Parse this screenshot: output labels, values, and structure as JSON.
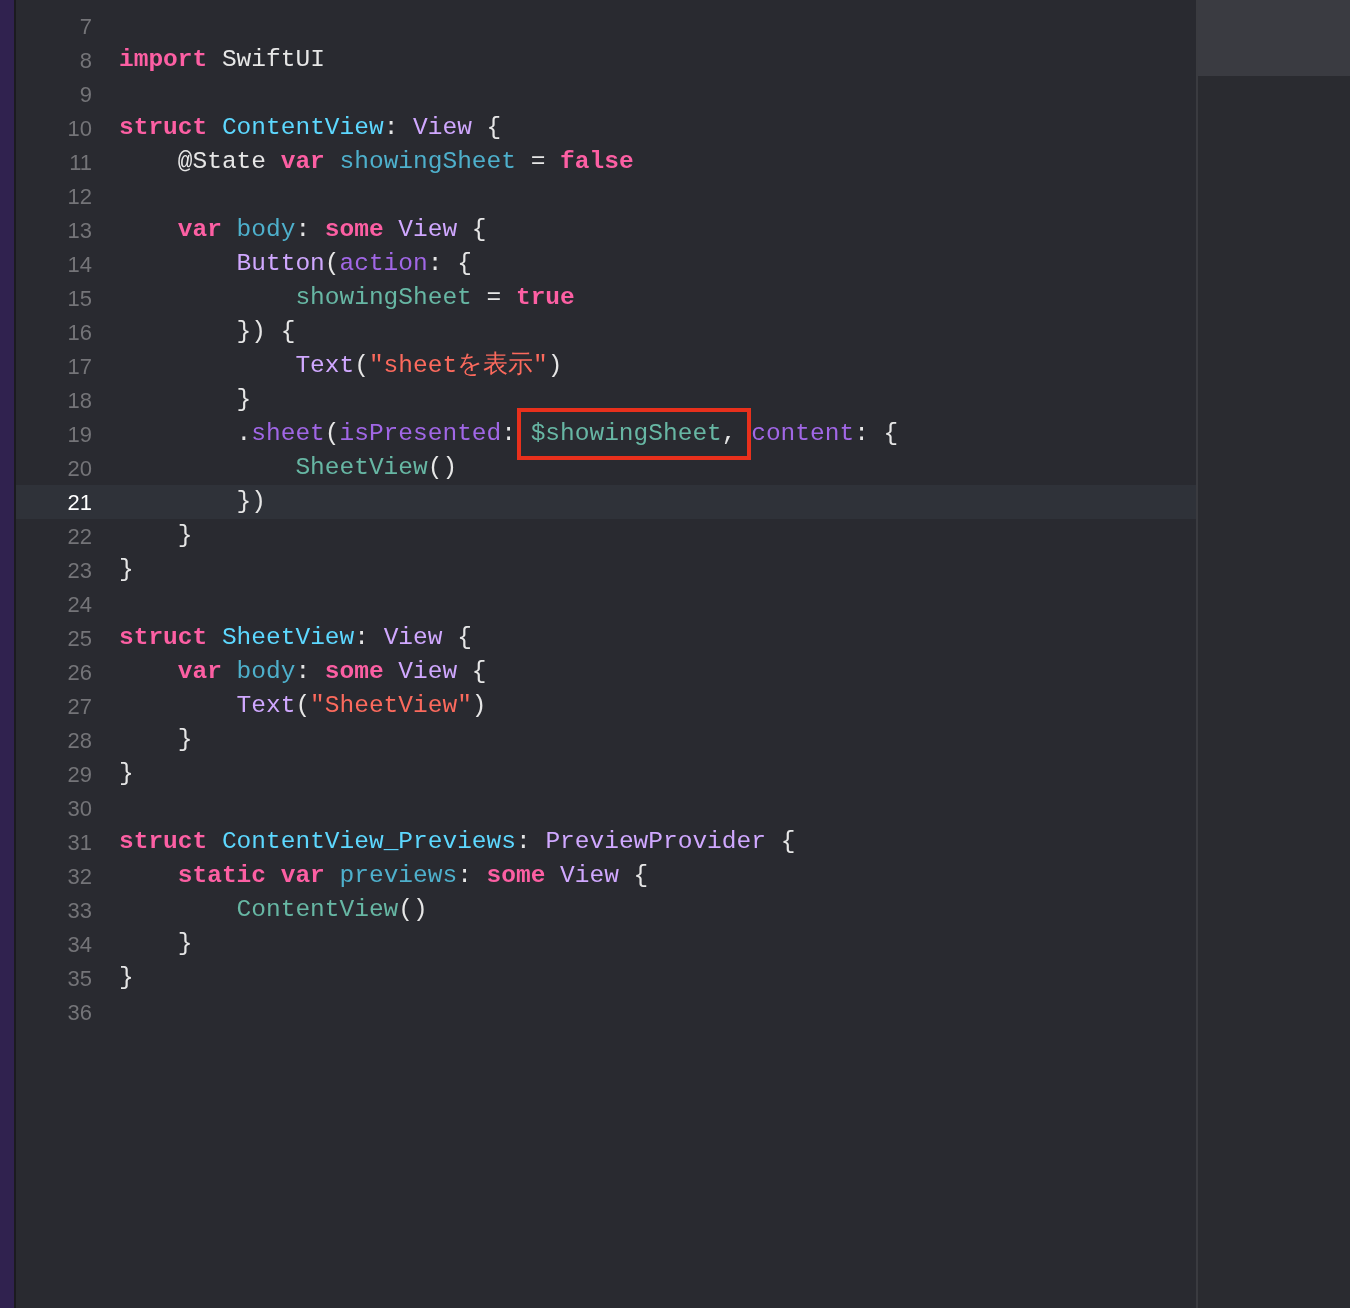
{
  "editor": {
    "lines": [
      {
        "number": "7",
        "current": false
      },
      {
        "number": "8",
        "current": false,
        "tokens": [
          {
            "kind": "keyword",
            "text": "import"
          },
          {
            "kind": "plain",
            "text": " SwiftUI"
          }
        ]
      },
      {
        "number": "9",
        "current": false
      },
      {
        "number": "10",
        "current": false,
        "tokens": [
          {
            "kind": "keyword",
            "text": "struct "
          },
          {
            "kind": "typedecl",
            "text": "ContentView"
          },
          {
            "kind": "plain",
            "text": ": "
          },
          {
            "kind": "type",
            "text": "View"
          },
          {
            "kind": "plain",
            "text": " {"
          }
        ],
        "children": [
          {
            "number": "11",
            "current": false,
            "tokens": [
              {
                "kind": "plain",
                "text": "@State "
              },
              {
                "kind": "keyword",
                "text": "var "
              },
              {
                "kind": "decl",
                "text": "showingSheet"
              },
              {
                "kind": "plain",
                "text": " = "
              },
              {
                "kind": "keyword",
                "text": "false"
              }
            ]
          },
          {
            "number": "12",
            "current": false
          },
          {
            "number": "13",
            "current": false,
            "tokens": [
              {
                "kind": "keyword",
                "text": "var "
              },
              {
                "kind": "decl",
                "text": "body"
              },
              {
                "kind": "plain",
                "text": ": "
              },
              {
                "kind": "keyword",
                "text": "some "
              },
              {
                "kind": "type",
                "text": "View"
              },
              {
                "kind": "plain",
                "text": " {"
              }
            ],
            "children": [
              {
                "number": "14",
                "current": false,
                "tokens": [
                  {
                    "kind": "type",
                    "text": "Button"
                  },
                  {
                    "kind": "plain",
                    "text": "("
                  },
                  {
                    "kind": "member",
                    "text": "action"
                  },
                  {
                    "kind": "plain",
                    "text": ": {"
                  }
                ],
                "children": [
                  {
                    "number": "15",
                    "current": false,
                    "tokens": [
                      {
                        "kind": "ident",
                        "text": "showingSheet"
                      },
                      {
                        "kind": "plain",
                        "text": " = "
                      },
                      {
                        "kind": "keyword",
                        "text": "true"
                      }
                    ]
                  }
                ]
              },
              {
                "number": "16",
                "current": false,
                "tokens": [
                  {
                    "kind": "plain",
                    "text": "}) {"
                  }
                ],
                "children": [
                  {
                    "number": "17",
                    "current": false,
                    "tokens": [
                      {
                        "kind": "type",
                        "text": "Text"
                      },
                      {
                        "kind": "plain",
                        "text": "("
                      },
                      {
                        "kind": "string",
                        "text": "\"sheetを表示\""
                      },
                      {
                        "kind": "plain",
                        "text": ")"
                      }
                    ]
                  }
                ]
              },
              {
                "number": "18",
                "current": false,
                "tokens": [
                  {
                    "kind": "plain",
                    "text": "}"
                  }
                ]
              },
              {
                "number": "19",
                "current": false,
                "tokens": [
                  {
                    "kind": "plain",
                    "text": "."
                  },
                  {
                    "kind": "member",
                    "text": "sheet"
                  },
                  {
                    "kind": "plain",
                    "text": "("
                  },
                  {
                    "kind": "member",
                    "text": "isPresented"
                  },
                  {
                    "kind": "plain",
                    "text": ": "
                  },
                  {
                    "kind": "annotation",
                    "tokens": [
                      {
                        "kind": "ident",
                        "text": "$showingSheet"
                      },
                      {
                        "kind": "plain",
                        "text": ","
                      }
                    ]
                  },
                  {
                    "kind": "member",
                    "text": " content"
                  },
                  {
                    "kind": "plain",
                    "text": ": {"
                  }
                ],
                "children": [
                  {
                    "number": "20",
                    "current": false,
                    "tokens": [
                      {
                        "kind": "ident",
                        "text": "SheetView"
                      },
                      {
                        "kind": "plain",
                        "text": "()"
                      }
                    ]
                  }
                ]
              },
              {
                "number": "21",
                "current": true,
                "tokens": [
                  {
                    "kind": "plain",
                    "text": "})"
                  }
                ]
              }
            ]
          },
          {
            "number": "22",
            "current": false,
            "tokens": [
              {
                "kind": "plain",
                "text": "}"
              }
            ]
          }
        ]
      },
      {
        "number": "23",
        "current": false,
        "tokens": [
          {
            "kind": "plain",
            "text": "}"
          }
        ]
      },
      {
        "number": "24",
        "current": false
      },
      {
        "number": "25",
        "current": false,
        "tokens": [
          {
            "kind": "keyword",
            "text": "struct "
          },
          {
            "kind": "typedecl",
            "text": "SheetView"
          },
          {
            "kind": "plain",
            "text": ": "
          },
          {
            "kind": "type",
            "text": "View"
          },
          {
            "kind": "plain",
            "text": " {"
          }
        ],
        "children": [
          {
            "number": "26",
            "current": false,
            "tokens": [
              {
                "kind": "keyword",
                "text": "var "
              },
              {
                "kind": "decl",
                "text": "body"
              },
              {
                "kind": "plain",
                "text": ": "
              },
              {
                "kind": "keyword",
                "text": "some "
              },
              {
                "kind": "type",
                "text": "View"
              },
              {
                "kind": "plain",
                "text": " {"
              }
            ],
            "children": [
              {
                "number": "27",
                "current": false,
                "tokens": [
                  {
                    "kind": "type",
                    "text": "Text"
                  },
                  {
                    "kind": "plain",
                    "text": "("
                  },
                  {
                    "kind": "string",
                    "text": "\"SheetView\""
                  },
                  {
                    "kind": "plain",
                    "text": ")"
                  }
                ]
              }
            ]
          },
          {
            "number": "28",
            "current": false,
            "tokens": [
              {
                "kind": "plain",
                "text": "}"
              }
            ]
          }
        ]
      },
      {
        "number": "29",
        "current": false,
        "tokens": [
          {
            "kind": "plain",
            "text": "}"
          }
        ]
      },
      {
        "number": "30",
        "current": false
      },
      {
        "number": "31",
        "current": false,
        "tokens": [
          {
            "kind": "keyword",
            "text": "struct "
          },
          {
            "kind": "typedecl",
            "text": "ContentView_Previews"
          },
          {
            "kind": "plain",
            "text": ": "
          },
          {
            "kind": "type",
            "text": "PreviewProvider"
          },
          {
            "kind": "plain",
            "text": " {"
          }
        ],
        "children": [
          {
            "number": "32",
            "current": false,
            "tokens": [
              {
                "kind": "keyword",
                "text": "static var "
              },
              {
                "kind": "decl",
                "text": "previews"
              },
              {
                "kind": "plain",
                "text": ": "
              },
              {
                "kind": "keyword",
                "text": "some "
              },
              {
                "kind": "type",
                "text": "View"
              },
              {
                "kind": "plain",
                "text": " {"
              }
            ],
            "children": [
              {
                "number": "33",
                "current": false,
                "tokens": [
                  {
                    "kind": "ident",
                    "text": "ContentView"
                  },
                  {
                    "kind": "plain",
                    "text": "()"
                  }
                ]
              }
            ]
          },
          {
            "number": "34",
            "current": false,
            "tokens": [
              {
                "kind": "plain",
                "text": "}"
              }
            ]
          }
        ]
      },
      {
        "number": "35",
        "current": false,
        "tokens": [
          {
            "kind": "plain",
            "text": "}"
          }
        ]
      },
      {
        "number": "36",
        "current": false
      }
    ]
  }
}
